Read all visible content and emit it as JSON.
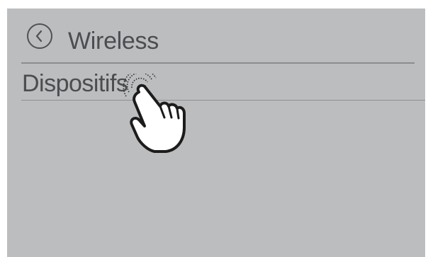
{
  "header": {
    "title": "Wireless",
    "back_icon": "chevron-left-circle-icon"
  },
  "list": {
    "items": [
      {
        "label": "Dispositifs"
      }
    ]
  },
  "overlay": {
    "gesture_icon": "tap-hand-icon"
  },
  "colors": {
    "screen_background": "#bcbdbf",
    "text": "#4c4d50",
    "divider": "#8b8c8e"
  }
}
